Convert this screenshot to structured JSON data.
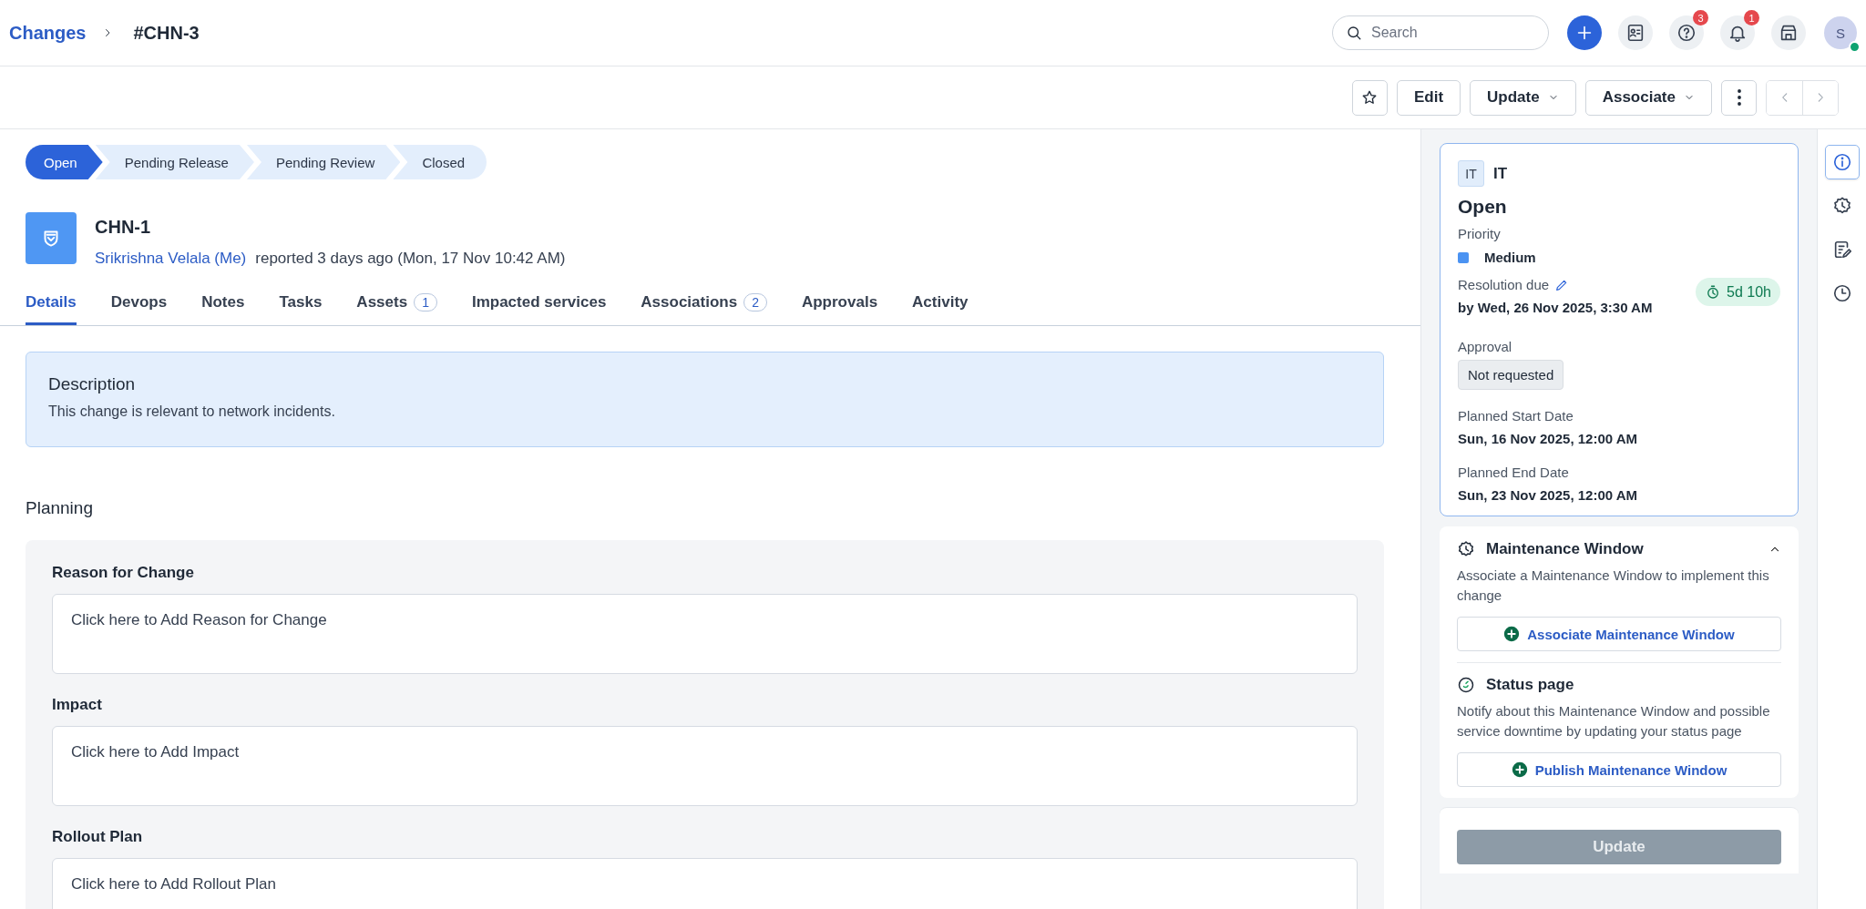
{
  "breadcrumb": {
    "parent": "Changes",
    "current": "#CHN-3"
  },
  "search": {
    "placeholder": "Search"
  },
  "header_actions": [
    {
      "kind": "add"
    },
    {
      "kind": "contacts"
    },
    {
      "kind": "help",
      "badge": "3"
    },
    {
      "kind": "bell",
      "badge": "1"
    },
    {
      "kind": "store"
    }
  ],
  "avatar": {
    "initial": "S",
    "online": true
  },
  "toolbar": [
    {
      "kind": "star"
    },
    {
      "kind": "text",
      "label": "Edit"
    },
    {
      "kind": "dropdown",
      "label": "Update"
    },
    {
      "kind": "dropdown",
      "label": "Associate"
    },
    {
      "kind": "more"
    },
    {
      "kind": "pager"
    }
  ],
  "stages": [
    {
      "label": "Open",
      "selected": true
    },
    {
      "label": "Pending Release",
      "selected": false
    },
    {
      "label": "Pending Review",
      "selected": false
    },
    {
      "label": "Closed",
      "selected": false
    }
  ],
  "record": {
    "title": "CHN-1",
    "reporter": "Srikrishna Velala (Me)",
    "reported": "reported 3 days ago (Mon, 17 Nov 10:42 AM)"
  },
  "tabs": [
    {
      "label": "Details",
      "selected": true
    },
    {
      "label": "Devops",
      "selected": false
    },
    {
      "label": "Notes",
      "selected": false
    },
    {
      "label": "Tasks",
      "selected": false
    },
    {
      "label": "Assets",
      "count": "1",
      "selected": false
    },
    {
      "label": "Impacted services",
      "selected": false
    },
    {
      "label": "Associations",
      "count": "2",
      "selected": false
    },
    {
      "label": "Approvals",
      "selected": false
    },
    {
      "label": "Activity",
      "selected": false
    }
  ],
  "description": {
    "title": "Description",
    "text": "This change is relevant to network incidents."
  },
  "planning": {
    "title": "Planning",
    "fields": [
      {
        "label": "Reason for Change",
        "placeholder": "Click here to Add Reason for Change"
      },
      {
        "label": "Impact",
        "placeholder": "Click here to Add Impact"
      },
      {
        "label": "Rollout Plan",
        "placeholder": "Click here to Add Rollout Plan"
      }
    ]
  },
  "summary": {
    "workspace_badge": "IT",
    "workspace": "IT",
    "status": "Open",
    "priority": {
      "label": "Priority",
      "value": "Medium",
      "color": "#4b93f2"
    },
    "resolution": {
      "label": "Resolution due",
      "value": "by Wed, 26 Nov 2025, 3:30 AM",
      "timer": "5d 10h"
    },
    "approval": {
      "label": "Approval",
      "value": "Not requested"
    },
    "dates": [
      {
        "label": "Planned Start Date",
        "value": "Sun, 16 Nov 2025, 12:00 AM"
      },
      {
        "label": "Planned End Date",
        "value": "Sun, 23 Nov 2025, 12:00 AM"
      }
    ]
  },
  "maintenance": {
    "title": "Maintenance Window",
    "expanded": true,
    "text": "Associate a Maintenance Window to implement this change",
    "button": "Associate Maintenance Window"
  },
  "status_page": {
    "title": "Status page",
    "text": "Notify about this Maintenance Window and possible service downtime by updating your status page",
    "button": "Publish Maintenance Window"
  },
  "update_button": {
    "label": "Update",
    "disabled": true
  },
  "rail": [
    {
      "kind": "info",
      "selected": true
    },
    {
      "kind": "gear",
      "selected": false
    },
    {
      "kind": "notes",
      "selected": false
    },
    {
      "kind": "history",
      "selected": false
    }
  ]
}
